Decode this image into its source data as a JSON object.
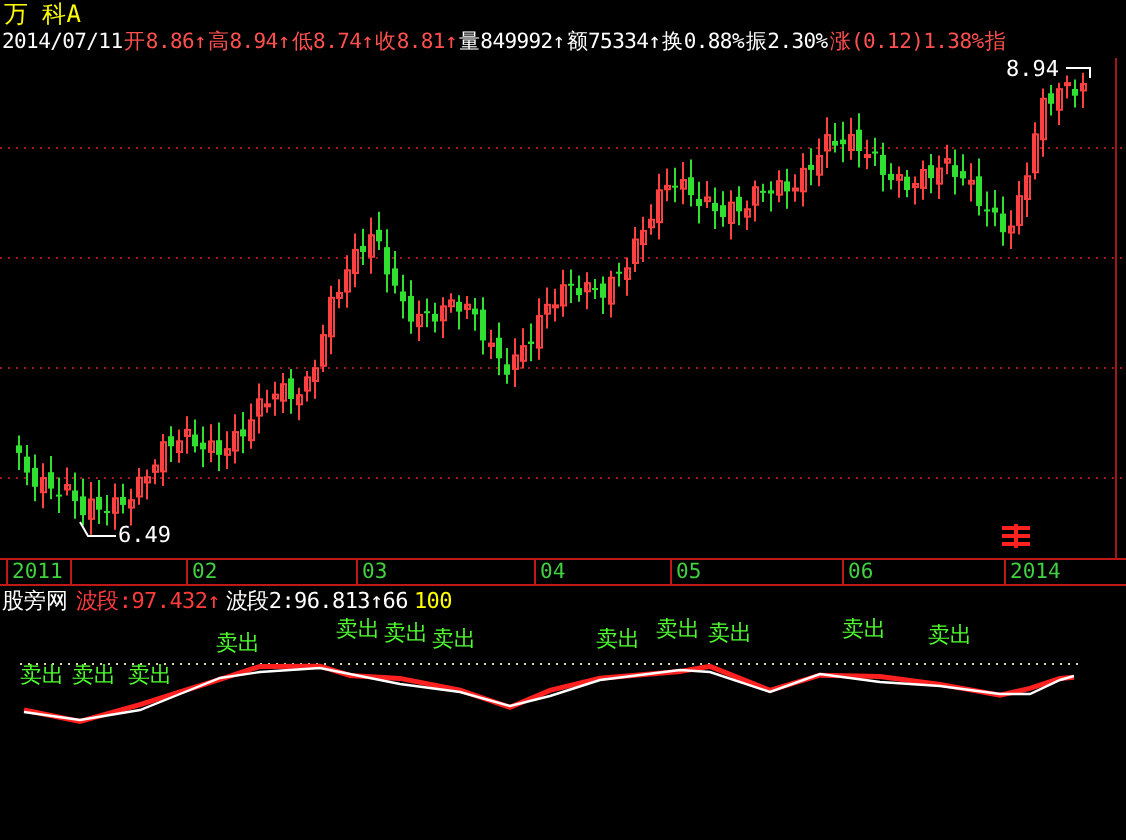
{
  "stock": {
    "name": "万 科A"
  },
  "quote": [
    {
      "text": "2014/07/11",
      "color": "#ffffff"
    },
    {
      "text": "开8.86↑",
      "color": "#ff5050"
    },
    {
      "text": "高8.94↑",
      "color": "#ff5050"
    },
    {
      "text": "低8.74↑",
      "color": "#ff5050"
    },
    {
      "text": "收8.81↑",
      "color": "#ff5050"
    },
    {
      "text": "量849992↑",
      "color": "#ffffff"
    },
    {
      "text": "额75334↑",
      "color": "#ffffff"
    },
    {
      "text": "换0.88%",
      "color": "#ffffff"
    },
    {
      "text": "振2.30%",
      "color": "#ffffff"
    },
    {
      "text": "涨(0.12)1.38%",
      "color": "#ff5050"
    },
    {
      "text": "指",
      "color": "#ff5050"
    }
  ],
  "main_chart": {
    "high_label": "8.94",
    "low_label": "6.49"
  },
  "x_axis": {
    "labels": [
      "2011",
      "02",
      "03",
      "04",
      "05",
      "06",
      "2014"
    ]
  },
  "indicator": {
    "name": "股旁网",
    "values": [
      {
        "text": "波段:97.432↑",
        "color": "#ff3c3c"
      },
      {
        "text": "波段2:96.813↑66",
        "color": "#ffffff"
      },
      {
        "text": "100",
        "color": "#ffff00"
      }
    ],
    "signals": [
      {
        "label": "卖出"
      },
      {
        "label": "卖出"
      },
      {
        "label": "卖出"
      },
      {
        "label": "卖出"
      },
      {
        "label": "卖出"
      },
      {
        "label": "卖出"
      },
      {
        "label": "卖出"
      },
      {
        "label": "卖出"
      },
      {
        "label": "卖出"
      },
      {
        "label": "卖出"
      },
      {
        "label": "卖出"
      },
      {
        "label": "卖出"
      }
    ]
  }
}
